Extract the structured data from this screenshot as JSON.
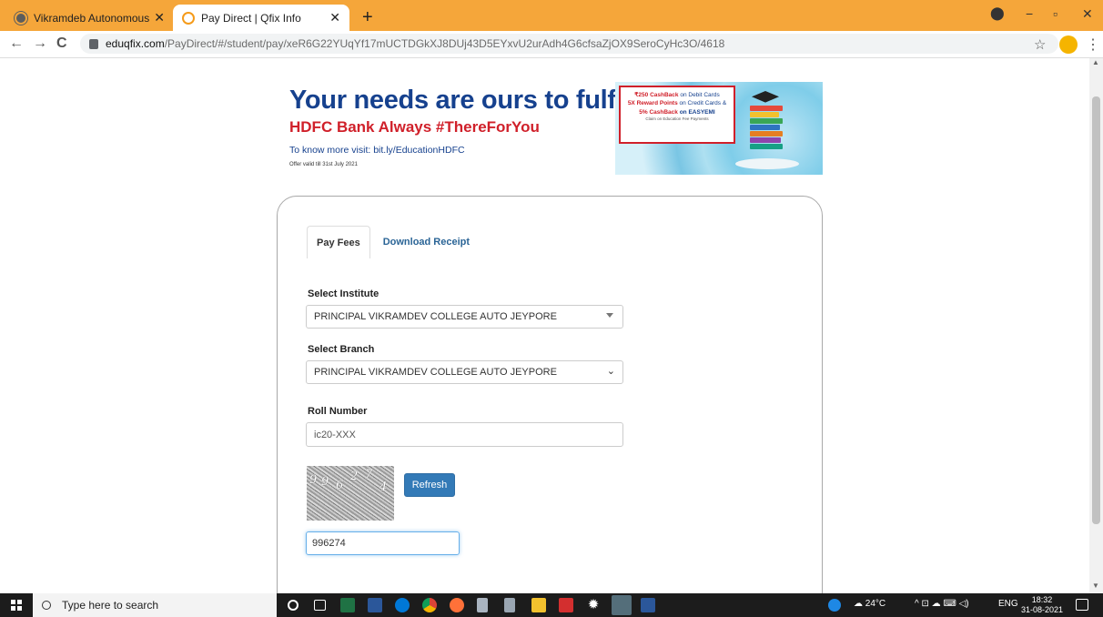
{
  "browser": {
    "tabs": [
      {
        "title": "Vikramdeb Autonomous Colleg",
        "active": false
      },
      {
        "title": "Pay Direct | Qfix Info",
        "active": true
      }
    ],
    "new_tab_label": "+",
    "window_controls": {
      "minimize": "−",
      "restore": "▫",
      "close": "✕"
    },
    "url_host": "eduqfix.com",
    "url_path": "/PayDirect/#/student/pay/xeR6G22YUqYf17mUCTDGkXJ8DUj43D5EYxvU2urAdh4G6cfsaZjOX9SeroCyHc3O/4618",
    "nav": {
      "back": "←",
      "forward": "→",
      "reload": "C"
    },
    "star": "☆",
    "menu": "⋮"
  },
  "banner": {
    "headline": "Your needs are ours to fulfil",
    "subline": "HDFC Bank Always #ThereForYou",
    "visit": "To know more visit: bit.ly/EducationHDFC",
    "valid": "Offer valid till 31st July 2021",
    "offer_line1_red": "₹250 CashBack",
    "offer_line1_blue": " on Debit Cards",
    "offer_line2_red": "5X Reward Points",
    "offer_line2_blue": " on Credit Cards &",
    "offer_line3_red": "5% CashBack",
    "offer_line3_blue": " on EASYEMI",
    "offer_small": "Claim on Education Fee Payments"
  },
  "form": {
    "tabs": [
      "Pay Fees",
      "Download Receipt"
    ],
    "institute_label": "Select Institute",
    "institute_value": "PRINCIPAL VIKRAMDEV COLLEGE AUTO JEYPORE",
    "branch_label": "Select Branch",
    "branch_value": "PRINCIPAL VIKRAMDEV COLLEGE AUTO JEYPORE",
    "roll_label": "Roll Number",
    "roll_value": "ic20-XXX",
    "captcha_chars": [
      "9",
      "9",
      "6",
      "2",
      "7",
      "4"
    ],
    "refresh_label": "Refresh",
    "captcha_value": "996274"
  },
  "taskbar": {
    "search_placeholder": "Type here to search",
    "weather": "24°C",
    "tray_icons": "^ ⊡ ☁ ⌨ ◁) ",
    "language": "ENG",
    "time": "18:32",
    "date": "31-08-2021"
  },
  "colors": {
    "tabstrip": "#f5a63a",
    "banner_blue": "#16418e",
    "banner_red": "#d0202a",
    "primary_button": "#337ab7"
  }
}
